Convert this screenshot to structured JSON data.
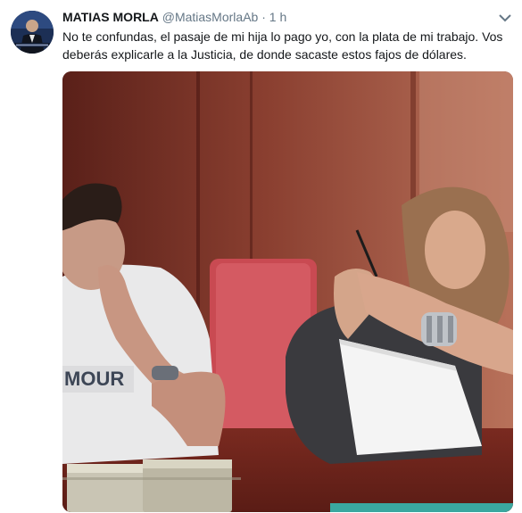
{
  "tweet": {
    "display_name": "MATIAS MORLA",
    "handle": "@MatiasMorlaAb",
    "separator": "·",
    "time": "1 h",
    "text": "No te confundas, el pasaje de mi hija lo pago yo, con la plata de mi trabajo. Vos deberás explicarle a la Justicia, de donde sacaste estos fajos de dólares.",
    "caret_icon": "chevron-down-icon",
    "photo_shirt_text": "MOUR"
  },
  "colors": {
    "name": "#14171a",
    "meta": "#657786",
    "text": "#14171a"
  }
}
